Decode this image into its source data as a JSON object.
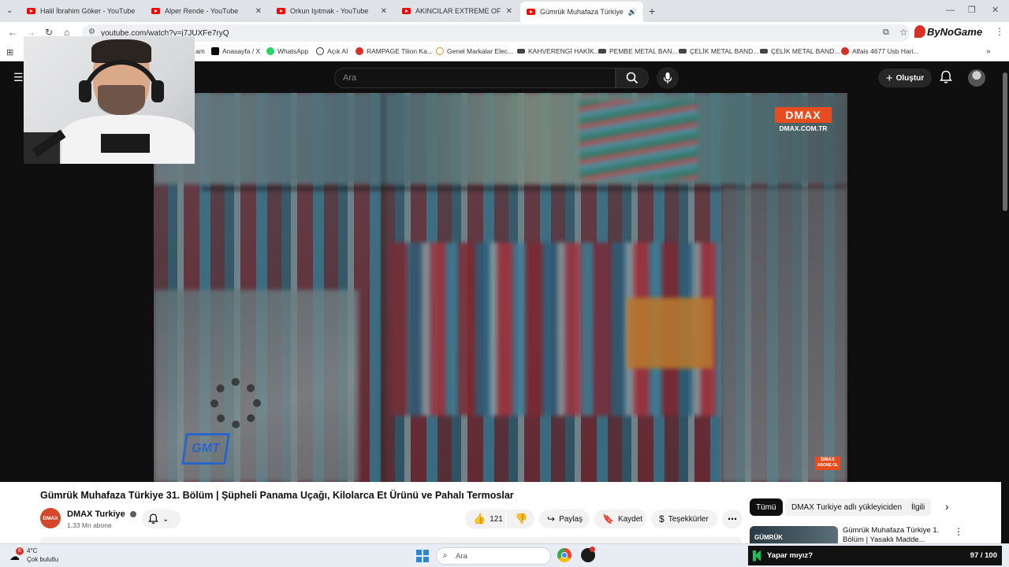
{
  "browser": {
    "tabs": [
      {
        "title": "Halil İbrahim Göker - YouTube"
      },
      {
        "title": "Alper Rende - YouTube"
      },
      {
        "title": "Orkun Işıtmak - YouTube"
      },
      {
        "title": "AKINCILAR EXTREME OFFROAD"
      },
      {
        "title": "Gümrük Muhafaza Türkiye"
      }
    ],
    "url": "youtube.com/watch?v=j7JUXFe7ryQ",
    "bookmarks": [
      {
        "label": "am",
        "color": "#e1306c"
      },
      {
        "label": "Anasayfa / X",
        "color": "#000000"
      },
      {
        "label": "WhatsApp",
        "color": "#25d366"
      },
      {
        "label": "Açık AI",
        "color": "#333333"
      },
      {
        "label": "RAMPAGE Tilion Ka...",
        "color": "#d93025"
      },
      {
        "label": "Genel Markalar Elec...",
        "color": "#f28b30"
      },
      {
        "label": "KAHVERENGİ HAKİK...",
        "color": "#444444"
      },
      {
        "label": "PEMBE METAL BAN...",
        "color": "#444444"
      },
      {
        "label": "ÇELİK METAL BAND...",
        "color": "#444444"
      },
      {
        "label": "ÇELİK METAL BAND...",
        "color": "#444444"
      },
      {
        "label": "Alfais 4677 Usb Hari...",
        "color": "#d93025"
      }
    ],
    "extension_label": "ByNoGame"
  },
  "youtube": {
    "search_placeholder": "Ara",
    "create_label": "Oluştur",
    "video": {
      "brand": "DMAX",
      "brand_url": "DMAX.COM.TR",
      "gmt_logo": "GMT",
      "corner_badge_line1": "DMAX",
      "corner_badge_line2": "ABONE OL"
    },
    "title": "Gümrük Muhafaza Türkiye 31. Bölüm | Şüpheli Panama Uçağı, Kilolarca Et Ürünü ve Pahalı Termoslar",
    "channel": {
      "avatar_text": "DMAX",
      "name": "DMAX Turkiye",
      "subscribers": "1,33 Mn abone"
    },
    "actions": {
      "likes": "121",
      "share": "Paylaş",
      "save": "Kaydet",
      "thanks": "Teşekkürler"
    },
    "chips": [
      "Tümü",
      "DMAX Turkiye adlı yükleyiciden",
      "İlgili"
    ],
    "suggested": {
      "thumb_text": "GÜMRÜK",
      "title_line1": "Gümrük Muhafaza Türkiye 1.",
      "title_line2": "Bölüm | Yasaklı Madde..."
    }
  },
  "taskbar": {
    "weather_badge": "6",
    "temperature": "4°C",
    "weather_desc": "Çok bulutlu",
    "search_placeholder": "Ara",
    "game_prompt": "Yapar mıyız?",
    "game_score": "97 / 100"
  }
}
